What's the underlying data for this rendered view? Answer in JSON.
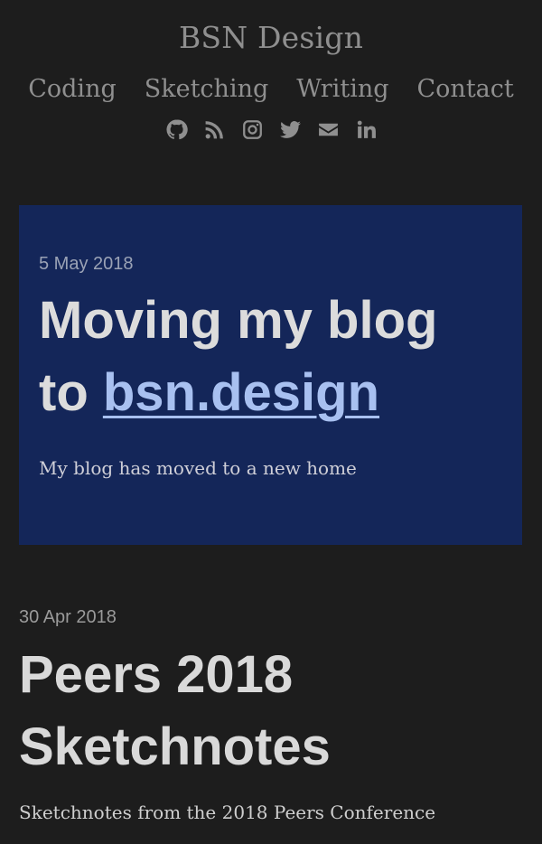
{
  "site": {
    "title": "BSN Design"
  },
  "nav": {
    "items": [
      {
        "label": "Coding"
      },
      {
        "label": "Sketching"
      },
      {
        "label": "Writing"
      },
      {
        "label": "Contact"
      }
    ]
  },
  "social": {
    "icons": [
      "github-icon",
      "rss-icon",
      "instagram-icon",
      "twitter-icon",
      "envelope-icon",
      "linkedin-icon"
    ],
    "color": "#8f8f8f"
  },
  "featured_post": {
    "date": "5 May 2018",
    "title_prefix": "Moving my blog to ",
    "title_link": "bsn.design",
    "excerpt": "My blog has moved to a new home",
    "background": "#142659",
    "link_color": "#a8c0f0"
  },
  "posts": [
    {
      "date": "30 Apr 2018",
      "title": "Peers 2018 Sketchnotes",
      "excerpt": "Sketchnotes from the 2018 Peers Conference"
    }
  ],
  "colors": {
    "background": "#1d1d1d",
    "muted_text": "#8f8f8f"
  }
}
